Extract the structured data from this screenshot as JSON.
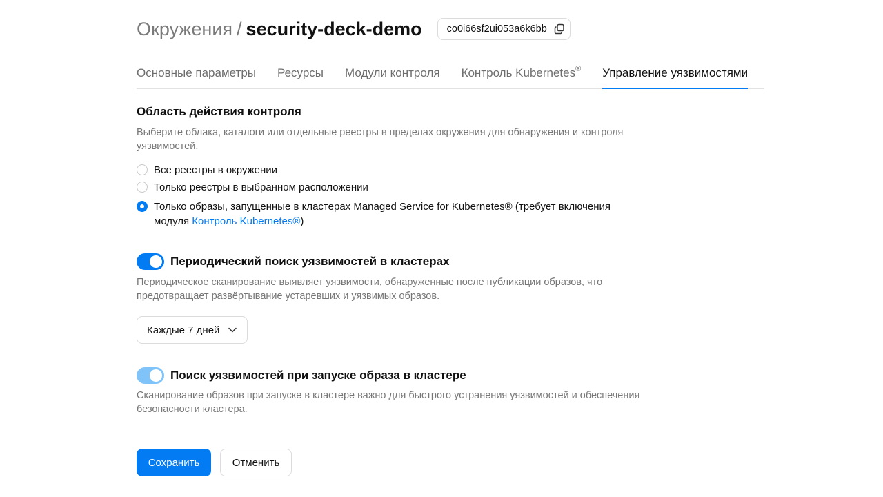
{
  "header": {
    "breadcrumb": "Окружения",
    "separator": "/",
    "title": "security-deck-demo",
    "environment_id": "co0i66sf2ui053a6k6bb"
  },
  "tabs": [
    {
      "label": "Основные параметры"
    },
    {
      "label": "Ресурсы"
    },
    {
      "label": "Модули контроля"
    },
    {
      "label": "Контроль Kubernetes",
      "suffix": "®"
    },
    {
      "label": "Управление уязвимостями",
      "active": true
    }
  ],
  "scope": {
    "title": "Область действия контроля",
    "description": "Выберите облака, каталоги или отдельные реестры в пределах окружения для обнаружения и контроля уязвимостей.",
    "options": [
      {
        "label": "Все реестры в окружении",
        "selected": false
      },
      {
        "label": "Только реестры в выбранном расположении",
        "selected": false
      },
      {
        "label": "Только образы, запущенные в кластерах Managed Service for Kubernetes® (требует включения модуля",
        "link": "Контроль Kubernetes®",
        "after_link": ")",
        "selected": true
      }
    ]
  },
  "periodic_scan": {
    "enabled": true,
    "label": "Периодический поиск уязвимостей в кластерах",
    "description": "Периодическое сканирование выявляет уязвимости, обнаруженные после публикации образов, что предотвращает развёртывание устаревших и уязвимых образов.",
    "interval": "Каждые 7 дней"
  },
  "launch_scan": {
    "enabled": true,
    "label": "Поиск уязвимостей при запуске образа в кластере",
    "description": "Сканирование образов при запуске в кластере важно для быстрого устранения уязвимостей и обеспечения безопасности кластера."
  },
  "actions": {
    "save": "Сохранить",
    "cancel": "Отменить"
  },
  "colors": {
    "accent": "#027bf3",
    "toggle_disabled_on": "#7fc3f9"
  }
}
